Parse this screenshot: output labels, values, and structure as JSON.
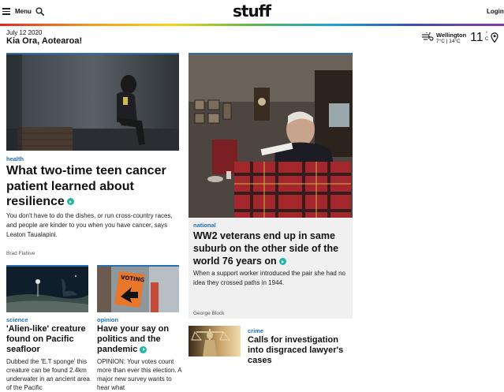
{
  "header": {
    "menu_label": "Menu",
    "brand": "stuff",
    "login_label": "Login",
    "icons": [
      "hamburger-menu-icon",
      "search-icon",
      "weather-icon",
      "location-pin-icon"
    ]
  },
  "info_bar": {
    "date": "July 12 2020",
    "greeting": "Kia Ora, Aotearoa!",
    "weather": {
      "city": "Wellington",
      "range": "7°C | 14°C",
      "temp": "11",
      "unit_top": "°",
      "unit_bottom": "C"
    }
  },
  "articles": [
    {
      "section": "health",
      "headline": "What two-time teen cancer patient learned about resilience",
      "summary": "You don't have to do the dishes, or run cross-country races, and people are kinder to you when you have cancer, says Leaton Taualapini.",
      "byline": "Brad Flahive",
      "has_video": true
    },
    {
      "section": "national",
      "headline": "WW2 veterans end up in same suburb on the other side of the world 76 years on",
      "summary": "When a support worker introduced the pair she had no idea they crossed paths in 1944.",
      "byline": "George Block",
      "has_video": true
    },
    {
      "section": "science",
      "headline": "'Alien-like' creature found on Pacific seafloor",
      "summary": "Dubbed the 'E.T sponge' this creature can be found 2.4km underwater in an ancient area of the Pacific",
      "has_video": false
    },
    {
      "section": "opinion",
      "headline": "Have your say on politics and the pandemic",
      "summary": "OPINION: Your votes count more than ever this election. A major new survey wants to hear what",
      "has_video": true,
      "image_sign_text": "VOTING"
    },
    {
      "section": "crime",
      "headline": "Calls for investigation into disgraced lawyer's cases",
      "has_video": false
    }
  ]
}
